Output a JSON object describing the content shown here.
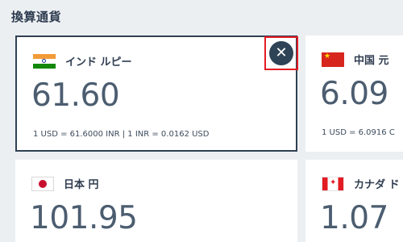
{
  "page": {
    "title": "換算通貨"
  },
  "cards": [
    {
      "id": "inr",
      "flag_icon": "india-flag-icon",
      "name": "インド ルピー",
      "rate": "61.60",
      "conversion": "1 USD = 61.6000 INR | 1 INR = 0.0162 USD",
      "selected": true
    },
    {
      "id": "cny",
      "flag_icon": "china-flag-icon",
      "name": "中国 元",
      "rate": "6.09",
      "conversion": "1 USD = 6.0916 C",
      "selected": false
    },
    {
      "id": "jpy",
      "flag_icon": "japan-flag-icon",
      "name": "日本 円",
      "rate": "101.95",
      "conversion": "",
      "selected": false
    },
    {
      "id": "cad",
      "flag_icon": "canada-flag-icon",
      "name": "カナダ ド",
      "rate": "1.07",
      "conversion": "",
      "selected": false
    }
  ],
  "close_button": {
    "icon": "close-icon",
    "glyph": "✕",
    "accent": "#2f4356",
    "highlight": "#e31c23"
  }
}
